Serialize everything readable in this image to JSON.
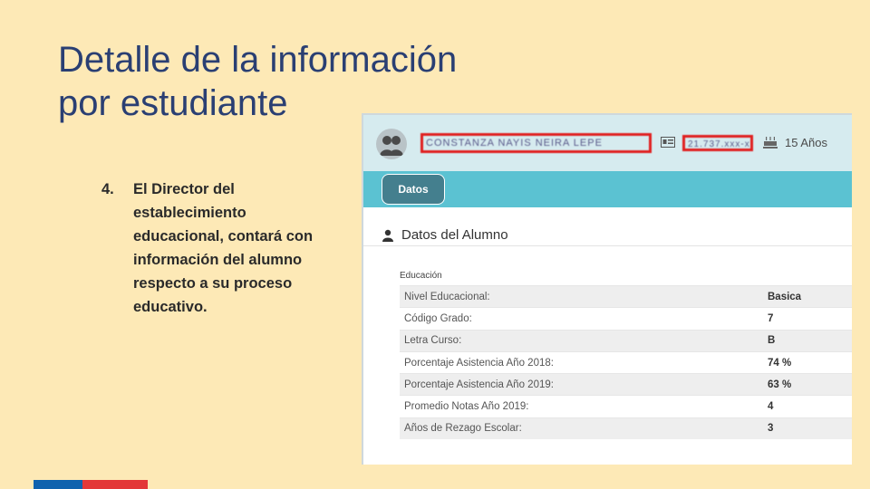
{
  "slide": {
    "title_line1": "Detalle de la información",
    "title_line2": "por estudiante",
    "bullet_number": "4.",
    "bullet_text": "El Director del establecimiento educacional, contará con información del alumno respecto a su proceso educativo."
  },
  "student_header": {
    "name_redacted": "CONSTANZA NAYIS NEIRA LEPE",
    "rut_redacted": "21.737.xxx-x",
    "age": "15 Años",
    "icons": [
      "avatar-icon",
      "id-card-icon",
      "cake-icon"
    ],
    "redaction_color": "#e02020"
  },
  "tabs": [
    {
      "label": "Datos",
      "active": true
    }
  ],
  "section": {
    "title": "Datos del Alumno",
    "icon": "user-icon",
    "group_label": "Educación"
  },
  "education_rows": [
    {
      "label": "Nivel Educacional:",
      "value": "Basica"
    },
    {
      "label": "Código Grado:",
      "value": "7"
    },
    {
      "label": "Letra Curso:",
      "value": "B"
    },
    {
      "label": "Porcentaje Asistencia Año 2018:",
      "value": "74 %"
    },
    {
      "label": "Porcentaje Asistencia Año 2019:",
      "value": "63 %"
    },
    {
      "label": "Promedio Notas Año 2019:",
      "value": "4"
    },
    {
      "label": "Años de Rezago Escolar:",
      "value": "3"
    }
  ],
  "colors": {
    "background": "#fde9b6",
    "title": "#2a3f73",
    "header_bg": "#d6ebef",
    "tab_bar": "#5bc2d2",
    "tab_active": "#447f8e",
    "flag_blue": "#0f62ae",
    "flag_red": "#e33838"
  }
}
